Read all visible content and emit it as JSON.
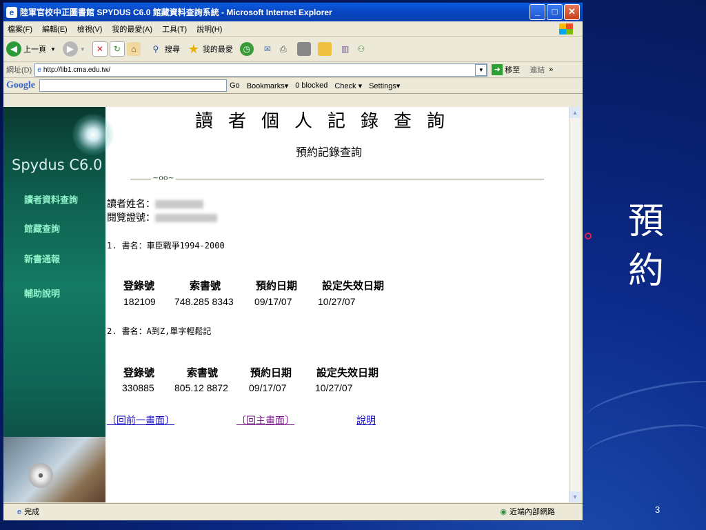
{
  "slide": {
    "title": "預約",
    "page_number": "3"
  },
  "window": {
    "title": "陸軍官校中正圖書館 SPYDUS C6.0 館藏資料查詢系統 - Microsoft Internet Explorer",
    "min": "_",
    "max": "□",
    "close": "✕"
  },
  "menu": [
    "檔案(F)",
    "編輯(E)",
    "檢視(V)",
    "我的最愛(A)",
    "工具(T)",
    "說明(H)"
  ],
  "toolbar": {
    "back": "上一頁",
    "search": "搜尋",
    "favorites": "我的最愛"
  },
  "address": {
    "label": "網址(D)",
    "url": "http://lib1.cma.edu.tw/",
    "go": "移至",
    "links": "連結"
  },
  "google": {
    "logo": "Google",
    "go": "Go",
    "bookmarks": "Bookmarks▾",
    "blocked": "0 blocked",
    "check": "Check ▾",
    "settings": "Settings▾"
  },
  "sidebar": {
    "brand": "Spydus C6.0",
    "links": [
      "讀者資料查詢",
      "館藏查詢",
      "新書通報",
      "輔助說明"
    ]
  },
  "page": {
    "heading": "讀者個人記錄查詢",
    "subheading": "預約記錄查詢",
    "ornament": "~oo~",
    "reader_name_label": "讀者姓名：",
    "card_label": "閱覽證號：",
    "columns": [
      "登錄號",
      "索書號",
      "預約日期",
      "設定失效日期"
    ],
    "books": [
      {
        "title": "1. 書名：車臣戰爭1994-2000",
        "reg": "182109",
        "call": "748.285 8343",
        "reserve": "09/17/07",
        "expire": "10/27/07"
      },
      {
        "title": "2. 書名：A到Z,單字輕鬆記",
        "reg": "330885",
        "call": "805.12 8872",
        "reserve": "09/17/07",
        "expire": "10/27/07"
      }
    ],
    "links": {
      "prev": "〔回前一畫面〕",
      "home": "〔回主畫面〕",
      "help": "說明"
    }
  },
  "status": {
    "done": "完成",
    "zone": "近端內部網路"
  }
}
